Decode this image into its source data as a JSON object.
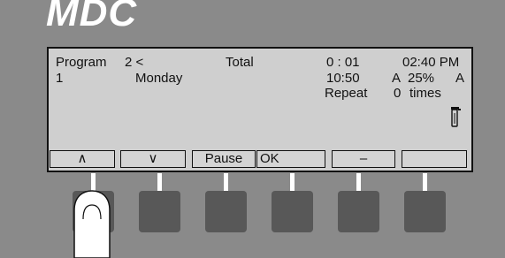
{
  "brand": {
    "logo_text": "MDC"
  },
  "display": {
    "program_label": "Program",
    "program_value": "2 <",
    "total_label": "Total",
    "total_time": "0 : 01",
    "clock": "02:40 PM",
    "row2_left": "1",
    "day": "Monday",
    "time2": "10:50",
    "mode_a1": "A",
    "percent": "25%",
    "mode_a2": "A",
    "repeat_label": "Repeat",
    "repeat_count": "0",
    "repeat_unit": "times",
    "status_icon": "tap-icon"
  },
  "softkeys": [
    {
      "label": "∧"
    },
    {
      "label": "∨"
    },
    {
      "label": "Pause"
    },
    {
      "label": "OK"
    },
    {
      "label": "–"
    },
    {
      "label": ""
    }
  ],
  "colors": {
    "panel": "#8a8a8a",
    "lcd": "#cfcfcf",
    "key": "#585858",
    "logo": "#ffffff"
  }
}
